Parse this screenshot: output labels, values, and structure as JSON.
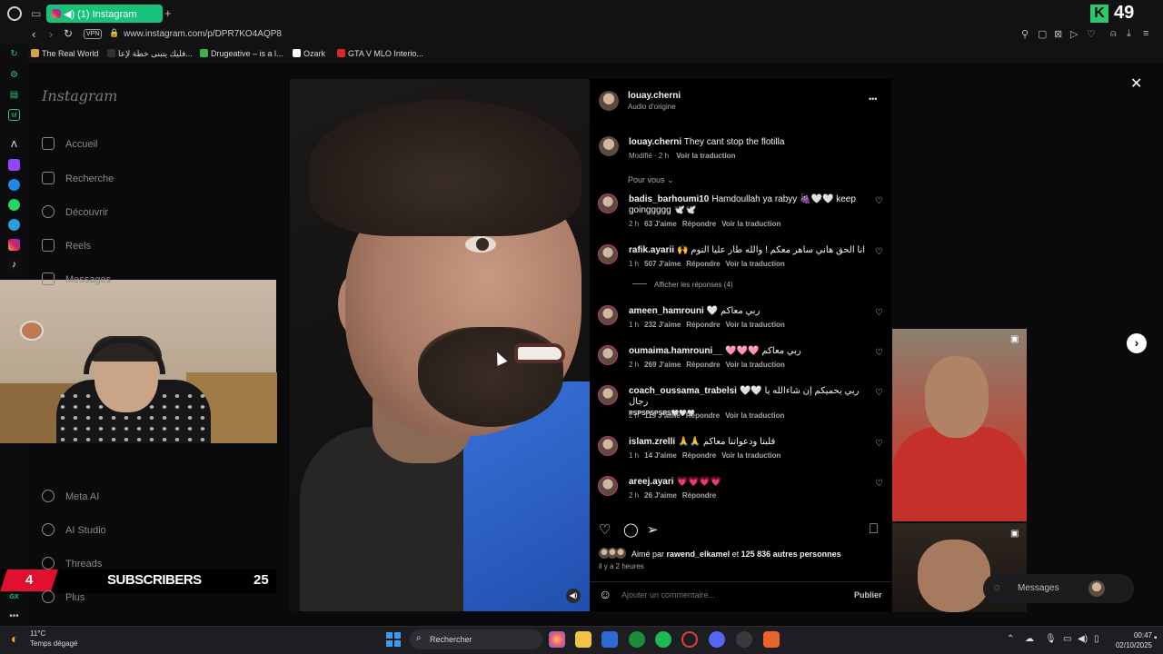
{
  "browser": {
    "tab_title": "(1) Instagram",
    "new_tab_symbol": "+",
    "url": "www.instagram.com/p/DPR7KO4AQP8",
    "vpn_label": "VPN",
    "counter_badge": "K",
    "counter_value": "49",
    "bookmarks": [
      {
        "label": "The Real World",
        "color": "#d4a052"
      },
      {
        "label": "فليك يتبنى خطة لإعا...",
        "color": "#333333"
      },
      {
        "label": "Drugeative – is a l...",
        "color": "#3bb34a"
      },
      {
        "label": "Ozark",
        "color": "#ffffff"
      },
      {
        "label": "GTA V MLO Interio...",
        "color": "#e02424"
      }
    ]
  },
  "sidebar": {
    "logo": "Instagram",
    "items": [
      {
        "label": "Accueil",
        "icon": "home-icon"
      },
      {
        "label": "Recherche",
        "icon": "search-icon"
      },
      {
        "label": "Découvrir",
        "icon": "compass-icon"
      },
      {
        "label": "Reels",
        "icon": "reels-icon"
      },
      {
        "label": "Messages",
        "icon": "messenger-icon"
      }
    ],
    "bottom_items": [
      {
        "label": "Meta AI",
        "icon": "meta-ai-icon"
      },
      {
        "label": "AI Studio",
        "icon": "ai-studio-icon"
      },
      {
        "label": "Threads",
        "icon": "threads-icon"
      },
      {
        "label": "Plus",
        "icon": "menu-icon"
      }
    ]
  },
  "overlay": {
    "subscriber_count": "4",
    "subscriber_label": "SUBSCRIBERS",
    "subscriber_goal": "25"
  },
  "post": {
    "author": "louay.cherni",
    "audio": "Audio d'origine",
    "caption_author": "louay.cherni",
    "caption": "They cant stop the flotilla",
    "caption_meta": "Modifié · 2 h",
    "translate": "Voir la traduction",
    "sort_label": "Pour vous",
    "comments": [
      {
        "user": "badis_barhoumi10",
        "text": "Hamdoullah ya rabyy 🍇🤍🤍 keep goinggggg 🕊️🕊️",
        "time": "2 h",
        "likes": "63 J'aime",
        "reply": "Répondre",
        "translate": "Voir la traduction"
      },
      {
        "user": "rafik.ayarii",
        "text": "🙌 انا الحق هاني ساهر معكم ! والله طار عليا النوم",
        "time": "1 h",
        "likes": "507 J'aime",
        "reply": "Répondre",
        "translate": "Voir la traduction"
      },
      {
        "user": "ameen_hamrouni",
        "text": "🤍 ربي معاكم",
        "time": "1 h",
        "likes": "232 J'aime",
        "reply": "Répondre",
        "translate": "Voir la traduction"
      },
      {
        "user": "oumaima.hamrouni__",
        "text": "🩷🩷🩷 ربي معاكم",
        "time": "2 h",
        "likes": "269 J'aime",
        "reply": "Répondre",
        "translate": "Voir la traduction"
      },
      {
        "user": "coach_oussama_trabelsi",
        "text": "🤍🤍 ربي يحميكم إن شاءالله يا رجال",
        "text2": "PSPSPSPSPS🤍🤍🤍",
        "time": "2 h",
        "likes": "119 J'aime",
        "reply": "Répondre",
        "translate": "Voir la traduction"
      },
      {
        "user": "islam.zrelli",
        "text": "🙏🙏 قلبنا ودعواتنا معاكم",
        "time": "1 h",
        "likes": "14 J'aime",
        "reply": "Répondre",
        "translate": "Voir la traduction"
      },
      {
        "user": "areej.ayari",
        "text": "💗💗💗💗",
        "time": "2 h",
        "likes": "26 J'aime",
        "reply": "Répondre",
        "translate": ""
      }
    ],
    "show_replies": "Afficher les réponses (4)",
    "likes_prefix": "Aimé par",
    "likes_user": "rawend_elkamel",
    "likes_and": "et",
    "likes_count": "125 836 autres personnes",
    "posted_ago": "il y a 2 heures",
    "comment_placeholder": "Ajouter un commentaire...",
    "publish": "Publier",
    "more_symbol": "•••"
  },
  "right": {
    "messages_label": "Messages"
  },
  "taskbar": {
    "temperature": "11°C",
    "weather": "Temps dégagé",
    "search": "Rechercher",
    "time": "00:47",
    "date": "02/10/2025"
  }
}
